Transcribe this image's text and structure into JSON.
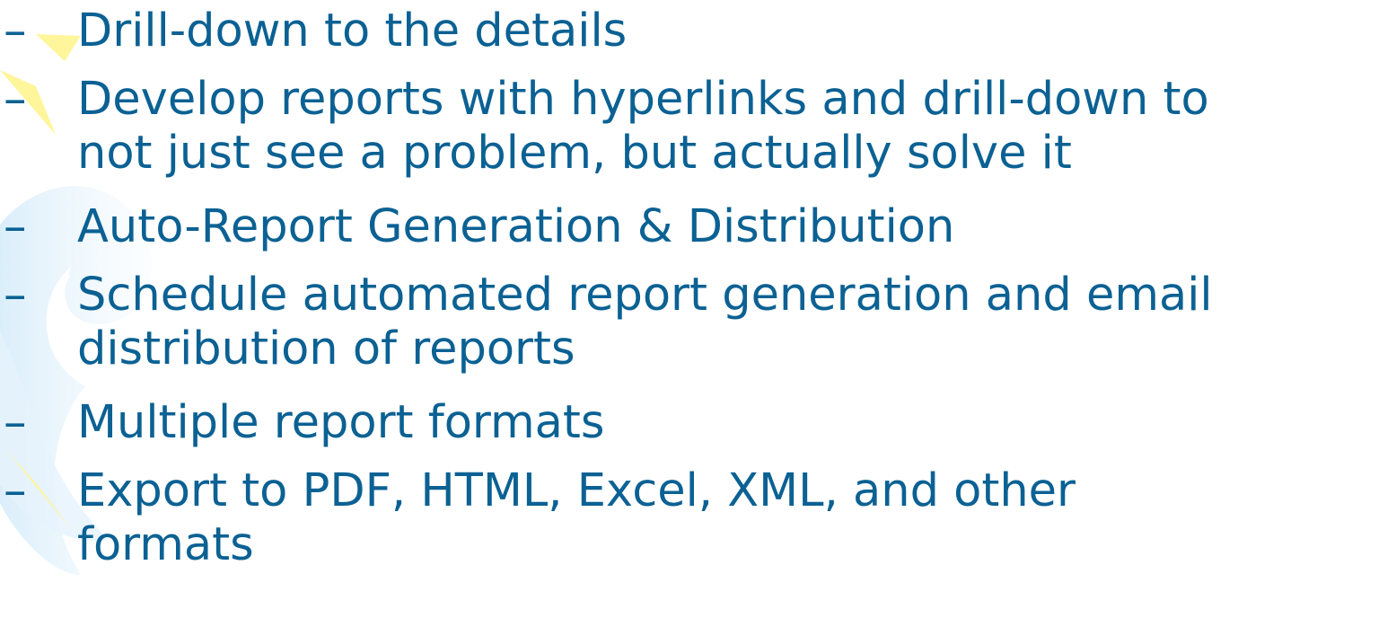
{
  "slide": {
    "bullet_marker": "–",
    "items": [
      {
        "lines": [
          "Drill-down to the details"
        ]
      },
      {
        "lines": [
          "Develop reports with hyperlinks and drill-down to",
          "not just see a problem, but actually solve it"
        ]
      },
      {
        "lines": [
          "Auto-Report Generation & Distribution"
        ]
      },
      {
        "lines": [
          "Schedule automated report generation and email",
          "distribution of reports"
        ]
      },
      {
        "lines": [
          "Multiple report formats"
        ]
      },
      {
        "lines": [
          "Export to PDF, HTML, Excel, XML, and other",
          "formats"
        ]
      }
    ]
  },
  "colors": {
    "text": "#0b6193",
    "accent_yellow": "#fff59a",
    "swirl_blue": "#d6ecfa"
  }
}
